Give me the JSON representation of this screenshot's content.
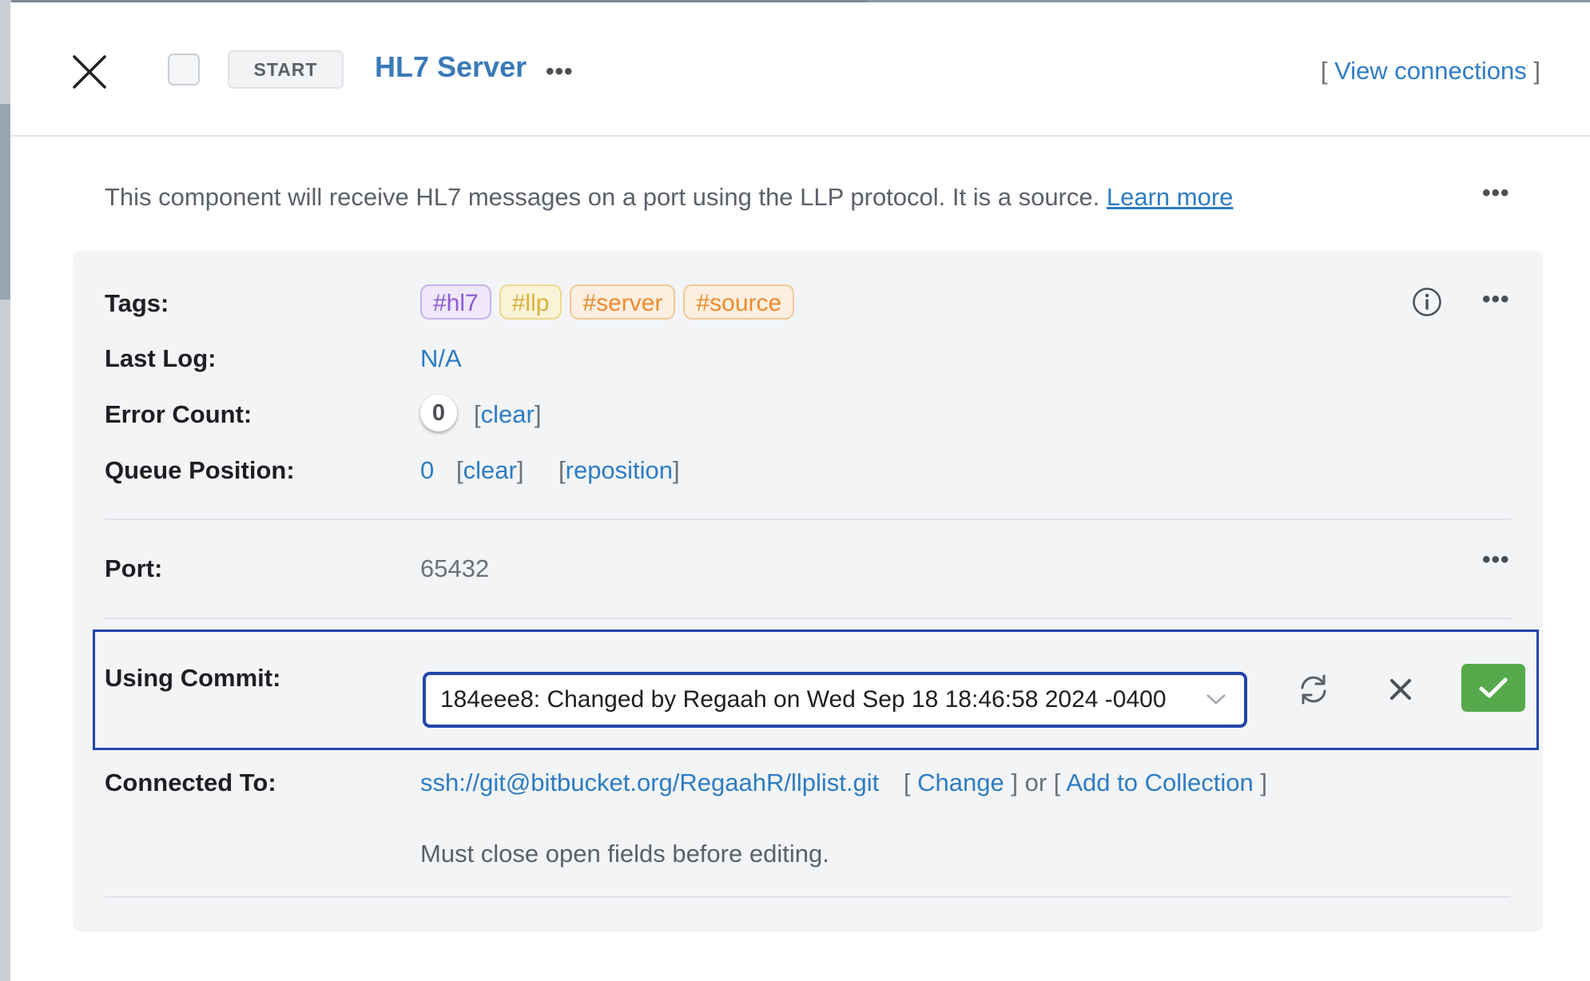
{
  "header": {
    "start_label": "START",
    "title": "HL7 Server",
    "more_label": "•••",
    "view_connections": {
      "open": "[ ",
      "label": "View connections",
      "close": " ]"
    }
  },
  "description": {
    "text": "This component will receive HL7 messages on a port using the LLP protocol.  It is a source.",
    "link": "Learn more"
  },
  "fields": {
    "tags_label": "Tags:",
    "tags": [
      "#hl7",
      "#llp",
      "#server",
      "#source"
    ],
    "last_log_label": "Last Log:",
    "last_log_value": "N/A",
    "error_count_label": "Error Count:",
    "error_count": "0",
    "clear_label": "clear",
    "queue_position_label": "Queue Position:",
    "queue_position": "0",
    "reposition_label": "reposition",
    "port_label": "Port:",
    "port_value": "65432",
    "using_commit_label": "Using Commit:",
    "commit_value": "184eee8: Changed by Regaah on Wed Sep 18 18:46:58 2024 -0400",
    "connected_to_label": "Connected To:",
    "connected_url": "ssh://git@bitbucket.org/RegaahR/llplist.git",
    "change_label": "Change",
    "or_label": "or",
    "add_to_collection_label": "Add to Collection",
    "note": "Must close open fields before editing."
  },
  "colors": {
    "accent_blue": "#2e7cc4",
    "focus_border": "#2246a8",
    "confirm_green": "#56a94a",
    "tag_hl7": "#8a5bd0",
    "tag_llp": "#d9b23b",
    "tag_server": "#ee8a2b",
    "tag_source": "#ee8a2b"
  },
  "icons": {
    "close": "close-icon",
    "info": "info-icon",
    "refresh": "refresh-icon",
    "cancel": "x-icon",
    "confirm": "checkmark-icon",
    "dropdown": "chevron-down-icon",
    "more": "ellipsis-icon"
  }
}
